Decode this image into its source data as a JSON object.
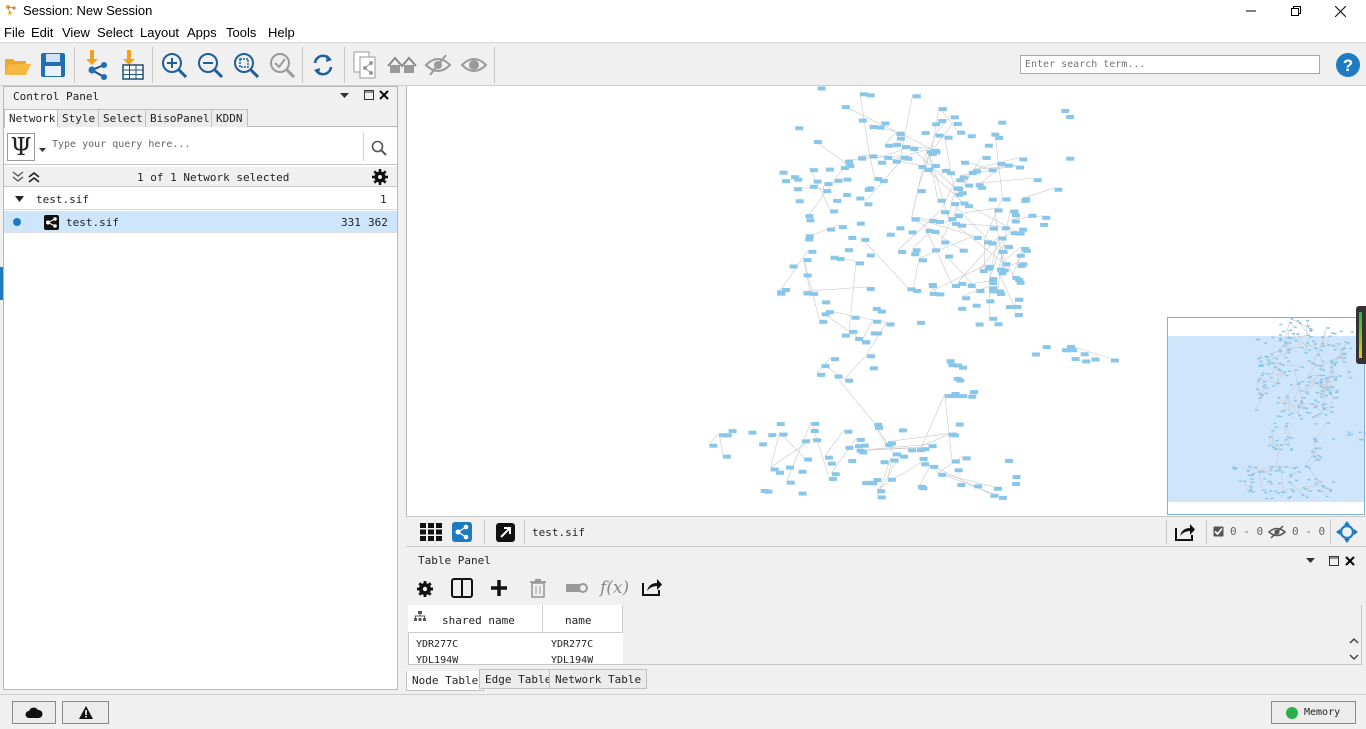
{
  "window": {
    "title": "Session: New Session"
  },
  "menu": [
    "File",
    "Edit",
    "View",
    "Select",
    "Layout",
    "Apps",
    "Tools",
    "Help"
  ],
  "toolbar": {
    "search_placeholder": "Enter search term..."
  },
  "control_panel": {
    "title": "Control Panel",
    "tabs": [
      "Network",
      "Style",
      "Select",
      "BisoPanel",
      "KDDN"
    ],
    "query_placeholder": "Type your query here...",
    "network_count": "1 of 1 Network selected",
    "collection": {
      "name": "test.sif",
      "count": "1"
    },
    "network": {
      "name": "test.sif",
      "nodes": "331",
      "edges": "362"
    }
  },
  "network_view": {
    "title": "test.sif",
    "selected_nodes": "0 - 0",
    "hidden": "0 - 0"
  },
  "table_panel": {
    "title": "Table Panel",
    "columns": [
      "shared name",
      "name"
    ],
    "rows": [
      [
        "YDR277C",
        "YDR277C"
      ],
      [
        "YDL194W",
        "YDL194W"
      ]
    ],
    "tabs": [
      "Node Table",
      "Edge Table",
      "Network Table"
    ]
  },
  "status": {
    "memory_label": "Memory"
  },
  "colors": {
    "node": "#88c7ea",
    "selection": "#cde6fb",
    "accent": "#1e7bc2",
    "memory_ok": "#2ab04a"
  }
}
